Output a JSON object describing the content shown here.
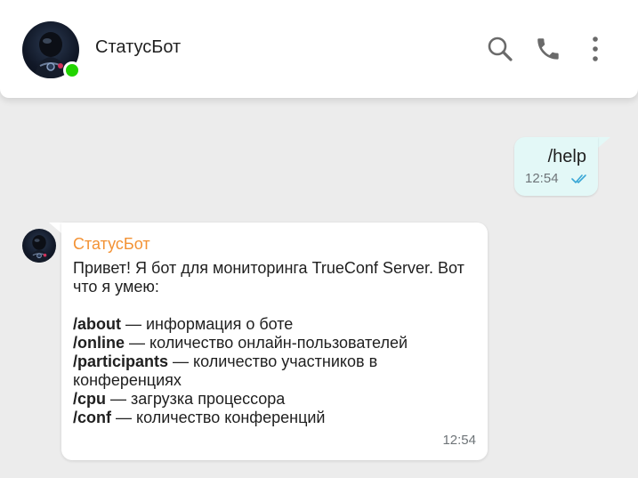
{
  "header": {
    "title": "СтатусБот",
    "icons": [
      "search-icon",
      "phone-icon",
      "more-vert-icon"
    ],
    "status": "online"
  },
  "messages": {
    "outgoing": {
      "text": "/help",
      "time": "12:54",
      "status": "read"
    },
    "incoming": {
      "sender": "СтатусБот",
      "intro": "Привет! Я бот для мониторинга TrueConf Server. Вот что я умею:",
      "commands": [
        {
          "cmd": "/about",
          "desc": " — информация о боте"
        },
        {
          "cmd": "/online",
          "desc": " — количество онлайн-пользователей"
        },
        {
          "cmd": "/participants",
          "desc": " — количество участников в конференциях"
        },
        {
          "cmd": "/cpu",
          "desc": " — загрузка процессора"
        },
        {
          "cmd": "/conf",
          "desc": " — количество конференций"
        }
      ],
      "time": "12:54"
    }
  },
  "colors": {
    "background": "#ececec",
    "header_bg": "#ffffff",
    "online_dot": "#22d400",
    "outgoing_bubble": "#e3f8f7",
    "sender_name": "#f39234",
    "read_ticks": "#3aa7d6"
  }
}
